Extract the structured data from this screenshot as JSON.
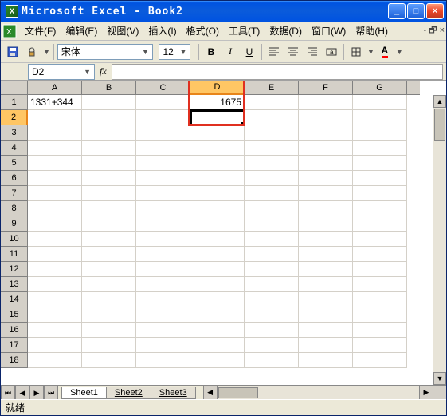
{
  "window": {
    "title": "Microsoft Excel - Book2"
  },
  "menu": {
    "file": "文件(F)",
    "edit": "编辑(E)",
    "view": "视图(V)",
    "insert": "插入(I)",
    "format": "格式(O)",
    "tools": "工具(T)",
    "data": "数据(D)",
    "window": "窗口(W)",
    "help": "帮助(H)"
  },
  "toolbar": {
    "font_name": "宋体",
    "font_size": "12",
    "bold": "B",
    "italic": "I",
    "underline": "U"
  },
  "formula": {
    "namebox": "D2",
    "fx": "fx",
    "formula_content": ""
  },
  "columns": [
    "A",
    "B",
    "C",
    "D",
    "E",
    "F",
    "G"
  ],
  "rows": [
    "1",
    "2",
    "3",
    "4",
    "5",
    "6",
    "7",
    "8",
    "9",
    "10",
    "11",
    "12",
    "13",
    "14",
    "15",
    "16",
    "17",
    "18"
  ],
  "cell_data": {
    "A1": "1331+344",
    "D1": "1675"
  },
  "active_column": "D",
  "active_row": "2",
  "highlight": {
    "col": "D",
    "rows_from": 0,
    "rows_to": 2
  },
  "sheets": {
    "active": "Sheet1",
    "tabs": [
      "Sheet1",
      "Sheet2",
      "Sheet3"
    ]
  },
  "status": "就绪",
  "chart_data": null
}
